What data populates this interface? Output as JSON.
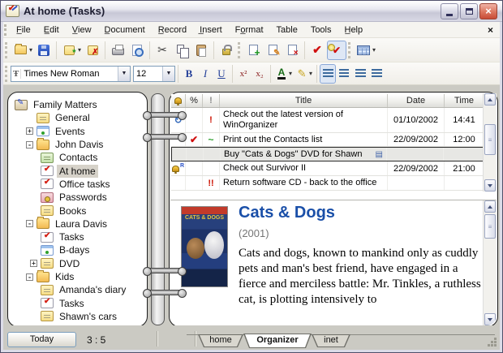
{
  "window": {
    "title": "At home (Tasks)"
  },
  "menubar": {
    "items": [
      "F̲ile",
      "E̲dit",
      "V̲iew",
      "D̲ocument",
      "R̲ecord",
      "I̲nsert",
      "Fo̲rmat",
      "Table",
      "Tools",
      "H̲elp"
    ],
    "close_glyph": "×"
  },
  "toolbar_main": {
    "buttons": [
      "open-notebook",
      "save",
      "new-note",
      "delete-note",
      "print",
      "print-preview",
      "cut",
      "copy",
      "paste",
      "protect",
      "add-record",
      "edit-record",
      "delete-record",
      "mark-complete",
      "hide-completed",
      "table-view"
    ]
  },
  "toolbar_format": {
    "font_name": "Times New Roman",
    "font_size": "12",
    "bold": "B",
    "italic": "I",
    "underline": "U",
    "superscript": "x²",
    "subscript": "x₂",
    "font_color_letter": "A"
  },
  "tree": {
    "items": [
      {
        "label": "Family Matters",
        "icon": "notebook",
        "expand": ""
      },
      {
        "label": "General",
        "icon": "note",
        "expand": ""
      },
      {
        "label": "Events",
        "icon": "calendar",
        "expand": "+"
      },
      {
        "label": "John Davis",
        "icon": "folder",
        "expand": "-"
      },
      {
        "label": "Contacts",
        "icon": "contacts",
        "expand": ""
      },
      {
        "label": "At home",
        "icon": "tasks",
        "expand": "",
        "selected": true
      },
      {
        "label": "Office tasks",
        "icon": "tasks",
        "expand": ""
      },
      {
        "label": "Passwords",
        "icon": "passwords",
        "expand": ""
      },
      {
        "label": "Books",
        "icon": "note",
        "expand": ""
      },
      {
        "label": "Laura Davis",
        "icon": "folder",
        "expand": "-"
      },
      {
        "label": "Tasks",
        "icon": "tasks",
        "expand": ""
      },
      {
        "label": "B-days",
        "icon": "calendar",
        "expand": ""
      },
      {
        "label": "DVD",
        "icon": "note",
        "expand": "+"
      },
      {
        "label": "Kids",
        "icon": "folder",
        "expand": "-"
      },
      {
        "label": "Amanda's diary",
        "icon": "note",
        "expand": ""
      },
      {
        "label": "Tasks",
        "icon": "tasks",
        "expand": ""
      },
      {
        "label": "Shawn's cars",
        "icon": "note",
        "expand": ""
      }
    ]
  },
  "tasks": {
    "header": {
      "alarm_icon": "bell",
      "pct": "%",
      "priority_icon": "!",
      "title": "Title",
      "date": "Date",
      "time": "Time"
    },
    "recurrence_glyph": "↻",
    "note_indicator_glyph": "▤",
    "rows": [
      {
        "alarm": "recurrence",
        "pct": "",
        "priority": "!",
        "title": "Check out the latest version of WinOrganizer",
        "date": "01/10/2002",
        "time": "14:41"
      },
      {
        "alarm": "",
        "pct": "✔",
        "priority": "~",
        "title": "Print out the Contacts list",
        "date": "22/09/2002",
        "time": "12:00"
      },
      {
        "alarm": "",
        "pct": "",
        "priority": "",
        "title": "Buy \"Cats & Dogs\" DVD for Shawn",
        "date": "",
        "time": "",
        "selected": true,
        "has_note": true
      },
      {
        "alarm": "bell",
        "alarm_sup": "R",
        "pct": "",
        "priority": "",
        "title": "Check out Survivor II",
        "date": "22/09/2002",
        "time": "21:00"
      },
      {
        "alarm": "",
        "pct": "",
        "priority": "!!",
        "title": "Return software CD - back to the office",
        "date": "",
        "time": ""
      }
    ]
  },
  "preview": {
    "title": "Cats & Dogs",
    "year": "(2001)",
    "body": "Cats and dogs, known to mankind only as cuddly pets and man's best friend, have engaged in a fierce and merciless battle: Mr. Tinkles, a ruthless cat, is plotting intensively to",
    "poster_text": "CATS & DOGS"
  },
  "statusbar": {
    "today": "Today",
    "count": "3 : 5"
  },
  "tabs": {
    "items": [
      "home",
      "Organizer",
      "inet"
    ],
    "active": "Organizer"
  },
  "colors": {
    "preview_title": "#1a4fa8",
    "priority_red": "#cc1100",
    "check_red": "#d01010",
    "tilde_green": "#2fa12f",
    "recurrence_blue": "#3a6ebd",
    "close_button": "#c84b35",
    "selected_tree_bg": "#d6d2c9"
  }
}
